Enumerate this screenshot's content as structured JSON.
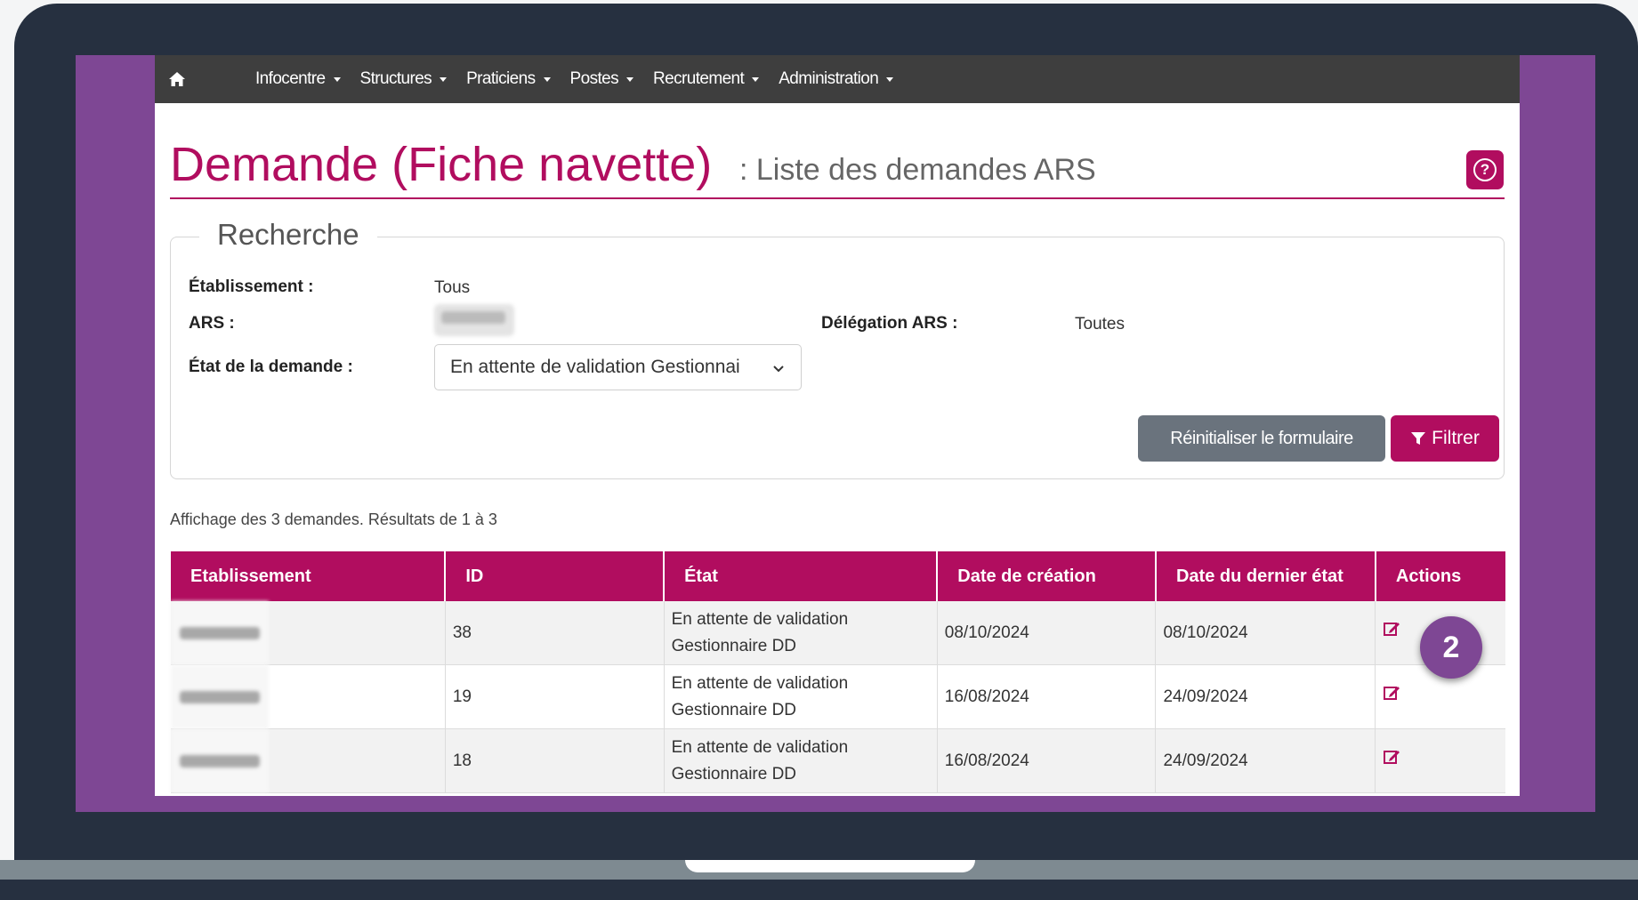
{
  "nav": {
    "items": [
      {
        "label": "Infocentre"
      },
      {
        "label": "Structures"
      },
      {
        "label": "Praticiens"
      },
      {
        "label": "Postes"
      },
      {
        "label": "Recrutement"
      },
      {
        "label": "Administration"
      }
    ]
  },
  "page": {
    "title": "Demande (Fiche navette)",
    "subtitle": ": Liste des demandes ARS",
    "help_label": "?"
  },
  "search": {
    "legend": "Recherche",
    "etablissement_label": "Établissement :",
    "etablissement_value": "Tous",
    "ars_label": "ARS :",
    "delegation_label": "Délégation ARS :",
    "delegation_value": "Toutes",
    "etat_label": "État de la demande :",
    "etat_value": "En attente de validation Gestionnai",
    "reset_label": "Réinitialiser le formulaire",
    "filter_label": "Filtrer"
  },
  "results": {
    "info": "Affichage des 3 demandes. Résultats de 1 à 3",
    "columns": [
      "Etablissement",
      "ID",
      "État",
      "Date de création",
      "Date du dernier état",
      "Actions"
    ],
    "rows": [
      {
        "id": "38",
        "etat_line1": "En attente de validation",
        "etat_line2": "Gestionnaire DD",
        "created": "08/10/2024",
        "last_state": "08/10/2024"
      },
      {
        "id": "19",
        "etat_line1": "En attente de validation",
        "etat_line2": "Gestionnaire DD",
        "created": "16/08/2024",
        "last_state": "24/09/2024"
      },
      {
        "id": "18",
        "etat_line1": "En attente de validation",
        "etat_line2": "Gestionnaire DD",
        "created": "16/08/2024",
        "last_state": "24/09/2024"
      }
    ]
  },
  "annotation": {
    "step": "2"
  },
  "colors": {
    "brand": "#b10d5f",
    "frame_purple": "#7e4794",
    "navbar": "#3e3e3e",
    "reset_button": "#6a737d"
  },
  "icons": [
    "home-icon",
    "question-icon",
    "chevron-down-icon",
    "filter-icon",
    "edit-icon"
  ]
}
